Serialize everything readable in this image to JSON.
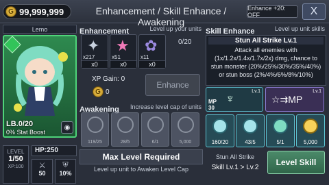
{
  "header": {
    "gold": "99,999,999",
    "gold_symbol": "G",
    "title": "Enhancement / Skill Enhance / Awakening",
    "enhance_toggle": "Enhance +20: OFF",
    "close_symbol": "X"
  },
  "character": {
    "name": "Lemo",
    "limit_break": "LB.0/20",
    "stat_boost": "0% Stat Boost",
    "level_label": "LEVEL",
    "level": "1/50",
    "xp": "XP:100",
    "hp": "HP:250",
    "atk": "50",
    "def": "10%"
  },
  "enhancement": {
    "title": "Enhancement",
    "subtitle": "Level up your units",
    "count": "0/20",
    "stones": [
      {
        "count": "x217",
        "owned": "x0",
        "icon": "silver-star-icon"
      },
      {
        "count": "x51",
        "owned": "x0",
        "icon": "pink-star-icon"
      },
      {
        "count": "x11",
        "owned": "x0",
        "icon": "fairy-icon"
      }
    ],
    "xp_gain": "XP Gain: 0",
    "cost": "0",
    "button": "Enhance"
  },
  "awakening": {
    "title": "Awakening",
    "subtitle": "Increase level cap of units",
    "slots": [
      {
        "count": "119/25"
      },
      {
        "count": "28/5"
      },
      {
        "count": "6/1"
      },
      {
        "count": "5,000"
      }
    ],
    "max_level": "Max Level Required",
    "note": "Level up unit to Awaken Level Cap"
  },
  "skill": {
    "title": "Skill Enhance",
    "subtitle": "Level up unit skills",
    "name": "Stun All Strike Lv.1",
    "description": "Attack all enemies with (1x/1.2x/1.4x/1.7x/2x) dmg, chance to stun monster (20%/25%/30%/35%/40%) or stun boss (2%/4%/6%/8%/10%)",
    "mp_label": "MP",
    "mp_value": "30",
    "skill1_level": "Lv.1",
    "skill2_level": "Lv.1",
    "slots": [
      {
        "count": "160/20"
      },
      {
        "count": "43/5"
      },
      {
        "count": "5/1"
      },
      {
        "count": "5,000"
      }
    ],
    "stun_label": "Stun All Strike",
    "level_change": "Skill Lv.1 > Lv.2",
    "button": "Level Skill"
  },
  "colors": {
    "accent": "#59b6c8",
    "gold": "#f7d25a",
    "frame": "#4fd47a"
  }
}
